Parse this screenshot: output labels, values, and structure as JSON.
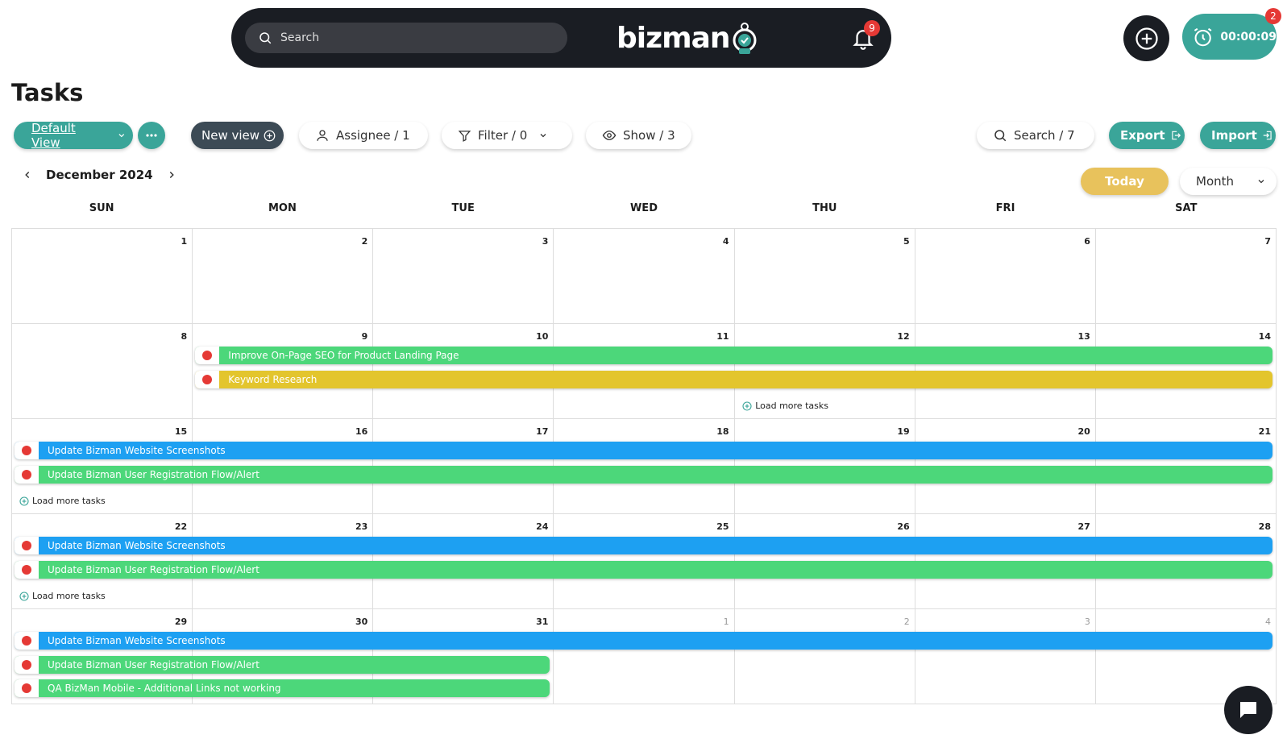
{
  "header": {
    "search_placeholder": "Search",
    "logo_text": "bizman",
    "notification_count": "9",
    "timer_value": "00:00:09",
    "timer_badge": "2"
  },
  "page": {
    "title": "Tasks"
  },
  "toolbar": {
    "default_view": "Default View",
    "new_view": "New view",
    "assignee": "Assignee / 1",
    "filter": "Filter / 0",
    "show": "Show / 3",
    "search": "Search / 7",
    "export": "Export",
    "import": "Import"
  },
  "calendar_nav": {
    "month_label": "December 2024",
    "today": "Today",
    "view_mode": "Month"
  },
  "weekdays": [
    "SUN",
    "MON",
    "TUE",
    "WED",
    "THU",
    "FRI",
    "SAT"
  ],
  "weeks": [
    {
      "days": [
        "1",
        "2",
        "3",
        "4",
        "5",
        "6",
        "7"
      ],
      "other": [
        false,
        false,
        false,
        false,
        false,
        false,
        false
      ],
      "tasks": [],
      "load_more": null
    },
    {
      "days": [
        "8",
        "9",
        "10",
        "11",
        "12",
        "13",
        "14"
      ],
      "other": [
        false,
        false,
        false,
        false,
        false,
        false,
        false
      ],
      "tasks": [
        {
          "label": "Improve On-Page SEO for Product Landing Page",
          "color": "#4cd77a",
          "start": 1,
          "end": 6
        },
        {
          "label": "Keyword Research",
          "color": "#e3c52d",
          "start": 1,
          "end": 6
        }
      ],
      "load_more": {
        "label": "Load more tasks",
        "day": 4
      }
    },
    {
      "days": [
        "15",
        "16",
        "17",
        "18",
        "19",
        "20",
        "21"
      ],
      "other": [
        false,
        false,
        false,
        false,
        false,
        false,
        false
      ],
      "tasks": [
        {
          "label": "Update Bizman Website Screenshots",
          "color": "#1da0f2",
          "start": 0,
          "end": 6
        },
        {
          "label": "Update Bizman User Registration Flow/Alert",
          "color": "#4cd77a",
          "start": 0,
          "end": 6
        }
      ],
      "load_more": {
        "label": "Load more tasks",
        "day": 0
      }
    },
    {
      "days": [
        "22",
        "23",
        "24",
        "25",
        "26",
        "27",
        "28"
      ],
      "other": [
        false,
        false,
        false,
        false,
        false,
        false,
        false
      ],
      "tasks": [
        {
          "label": "Update Bizman Website Screenshots",
          "color": "#1da0f2",
          "start": 0,
          "end": 6
        },
        {
          "label": "Update Bizman User Registration Flow/Alert",
          "color": "#4cd77a",
          "start": 0,
          "end": 6
        }
      ],
      "load_more": {
        "label": "Load more tasks",
        "day": 0
      }
    },
    {
      "days": [
        "29",
        "30",
        "31",
        "1",
        "2",
        "3",
        "4"
      ],
      "other": [
        false,
        false,
        false,
        true,
        true,
        true,
        true
      ],
      "tasks": [
        {
          "label": "Update Bizman Website Screenshots",
          "color": "#1da0f2",
          "start": 0,
          "end": 6
        },
        {
          "label": "Update Bizman User Registration Flow/Alert",
          "color": "#4cd77a",
          "start": 0,
          "end": 2
        },
        {
          "label": "QA BizMan Mobile - Additional Links not working",
          "color": "#4cd77a",
          "start": 0,
          "end": 2
        }
      ],
      "load_more": null
    }
  ],
  "icons": {
    "search": "search-icon",
    "bell": "bell-icon",
    "add": "plus-circle-icon",
    "timer": "alarm-clock-icon",
    "chat": "chat-icon"
  }
}
